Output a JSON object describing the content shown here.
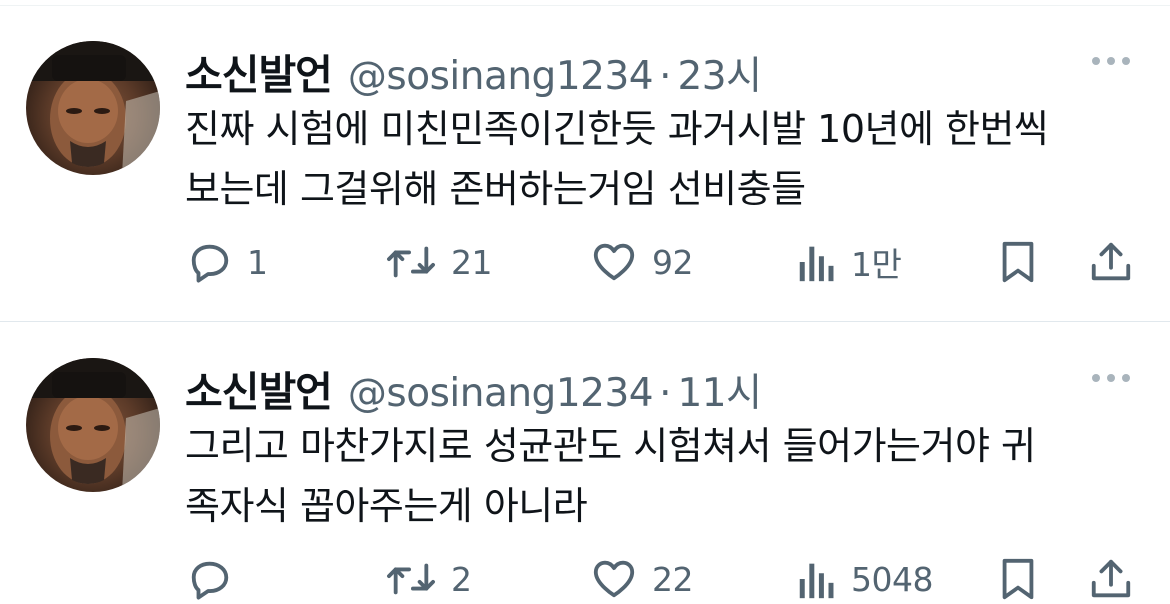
{
  "tweets": [
    {
      "display_name": "소신발언",
      "handle": "@sosinang1234",
      "separator": "·",
      "time": "23시",
      "text_line1": "진짜 시험에 미친민족이긴한듯 과거시발 10년에 한번씩",
      "text_line2": "보는데 그걸위해 존버하는거임 선비충들",
      "replies": "1",
      "retweets": "21",
      "likes": "92",
      "views": "1만"
    },
    {
      "display_name": "소신발언",
      "handle": "@sosinang1234",
      "separator": "·",
      "time": "11시",
      "text_line1": "그리고 마찬가지로 성균관도 시험쳐서 들어가는거야 귀",
      "text_line2": "족자식 꼽아주는게 아니라",
      "replies": "",
      "retweets": "2",
      "likes": "22",
      "views": "5048"
    }
  ],
  "icons": {
    "reply": "reply-icon",
    "retweet": "retweet-icon",
    "like": "heart-icon",
    "views": "views-icon",
    "bookmark": "bookmark-icon",
    "share": "share-icon",
    "more": "more-icon"
  },
  "colors": {
    "text": "#0f1419",
    "secondary": "#536471",
    "divider": "#e1e8ed"
  }
}
